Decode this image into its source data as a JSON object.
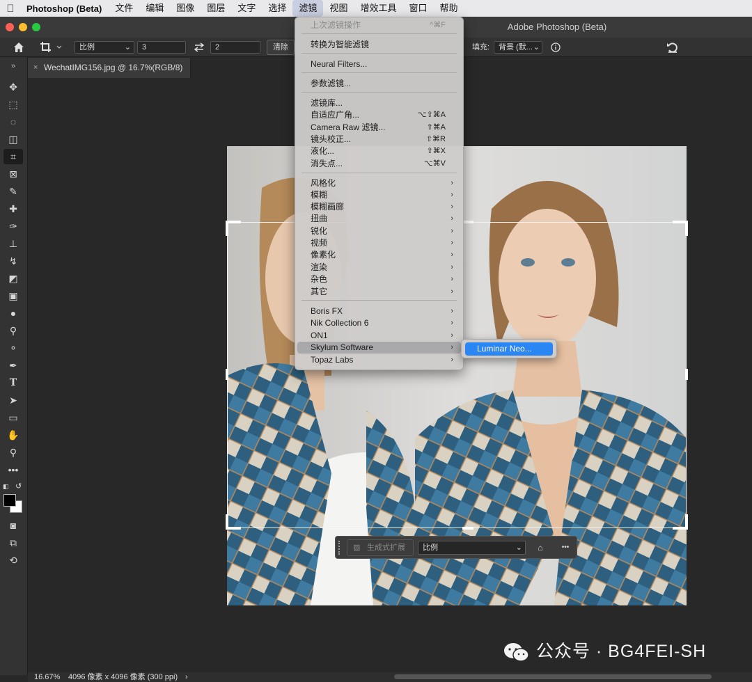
{
  "menubar": {
    "app_name": "Photoshop (Beta)",
    "items": [
      "文件",
      "编辑",
      "图像",
      "图层",
      "文字",
      "选择",
      "滤镜",
      "视图",
      "增效工具",
      "窗口",
      "帮助"
    ],
    "active_item": "滤镜"
  },
  "window": {
    "title": "Adobe Photoshop (Beta)"
  },
  "options_bar": {
    "ratio_select": "比例",
    "width_value": "3",
    "height_value": "2",
    "clear_label": "清除",
    "fill_label": "填充:",
    "fill_select": "背景 (默...",
    "icons": [
      "home-icon",
      "crop-icon",
      "swap-icon",
      "info-icon",
      "reset-icon"
    ]
  },
  "document_tab": {
    "title": "WechatIMG156.jpg @ 16.7%(RGB/8)",
    "close_glyph": "×"
  },
  "filter_menu": {
    "items": [
      {
        "label": "上次滤镜操作",
        "shortcut": "^⌘F",
        "disabled": true
      },
      {
        "label": "转换为智能滤镜"
      },
      {
        "label": "Neural Filters..."
      },
      {
        "label": "参数滤镜..."
      },
      {
        "label": "滤镜库..."
      },
      {
        "label": "自适应广角...",
        "shortcut": "⌥⇧⌘A"
      },
      {
        "label": "Camera Raw 滤镜...",
        "shortcut": "⇧⌘A"
      },
      {
        "label": "镜头校正...",
        "shortcut": "⇧⌘R"
      },
      {
        "label": "液化...",
        "shortcut": "⇧⌘X"
      },
      {
        "label": "消失点...",
        "shortcut": "⌥⌘V"
      },
      {
        "label": "风格化",
        "submenu": true
      },
      {
        "label": "模糊",
        "submenu": true
      },
      {
        "label": "模糊画廊",
        "submenu": true
      },
      {
        "label": "扭曲",
        "submenu": true
      },
      {
        "label": "锐化",
        "submenu": true
      },
      {
        "label": "视频",
        "submenu": true
      },
      {
        "label": "像素化",
        "submenu": true
      },
      {
        "label": "渲染",
        "submenu": true
      },
      {
        "label": "杂色",
        "submenu": true
      },
      {
        "label": "其它",
        "submenu": true
      },
      {
        "label": "Boris FX",
        "submenu": true
      },
      {
        "label": "Nik Collection 6",
        "submenu": true
      },
      {
        "label": "ON1",
        "submenu": true
      },
      {
        "label": "Skylum Software",
        "submenu": true,
        "highlighted": true
      },
      {
        "label": "Topaz Labs",
        "submenu": true
      }
    ],
    "submenu_arrow": "›"
  },
  "submenu": {
    "item": "Luminar Neo..."
  },
  "context_bar": {
    "generative_expand": "生成式扩展",
    "ratio_select": "比例",
    "more_glyph": "•••"
  },
  "status_bar": {
    "zoom": "16.67%",
    "info": "4096 像素 x 4096 像素 (300 ppi)",
    "arrow": "›"
  },
  "watermark": {
    "text": "公众号 · BG4FEI-SH"
  },
  "colors": {
    "accent": "#2a86f2",
    "menubar": "#e9e9eb",
    "ui_dark": "#323232"
  }
}
